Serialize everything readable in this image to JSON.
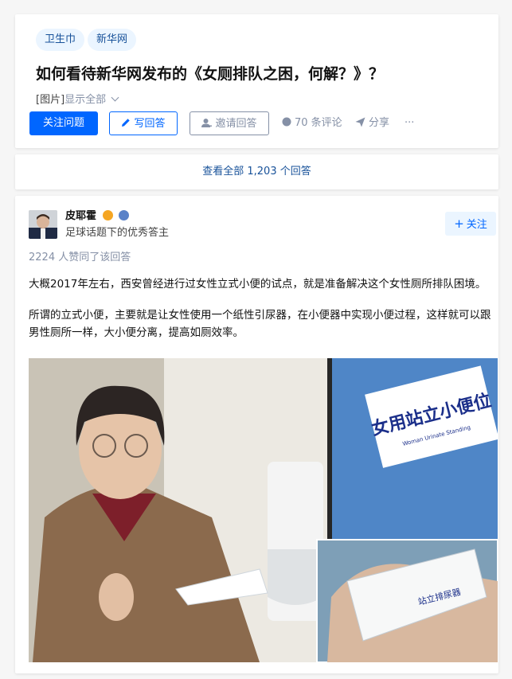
{
  "question": {
    "topics": [
      "卫生巾",
      "新华网"
    ],
    "title": "如何看待新华网发布的《女厕排队之困，何解？》？",
    "excerpt_prefix": "[图片]",
    "excerpt_more": "显示全部",
    "follow_label": "关注问题",
    "write_label": "写回答",
    "invite_label": "邀请回答",
    "comments_label": "70 条评论",
    "share_label": "分享",
    "more_label": "···"
  },
  "answers_link": "查看全部 1,203 个回答",
  "answer": {
    "author_name": "皮耶霍",
    "author_desc": "足球话题下的优秀答主",
    "follow_label": "关注",
    "follow_plus": "+",
    "votes": "2224 人赞同了该回答",
    "paragraphs": [
      "大概2017年左右，西安曾经进行过女性立式小便的试点，就是准备解决这个女性厕所排队困境。",
      "所谓的立式小便，主要就是让女性使用一个纸性引尿器，在小便器中实现小便过程，这样就可以跟男性厕所一样，大小便分离，提高如厕效率。"
    ],
    "photo": {
      "sign_text": "女用站立小便位",
      "sign_subtext": "Woman  Urinate  Standing",
      "device_text": "站立排尿器"
    }
  },
  "colors": {
    "primary": "#0066ff",
    "link": "#175199",
    "muted": "#8590a6",
    "tag_bg": "#ebf5ff"
  },
  "icons": [
    "pencil-icon",
    "invite-user-icon",
    "comment-icon",
    "share-icon",
    "plus-icon",
    "gold-badge-icon",
    "verified-badge-icon",
    "chevron-down-icon"
  ]
}
